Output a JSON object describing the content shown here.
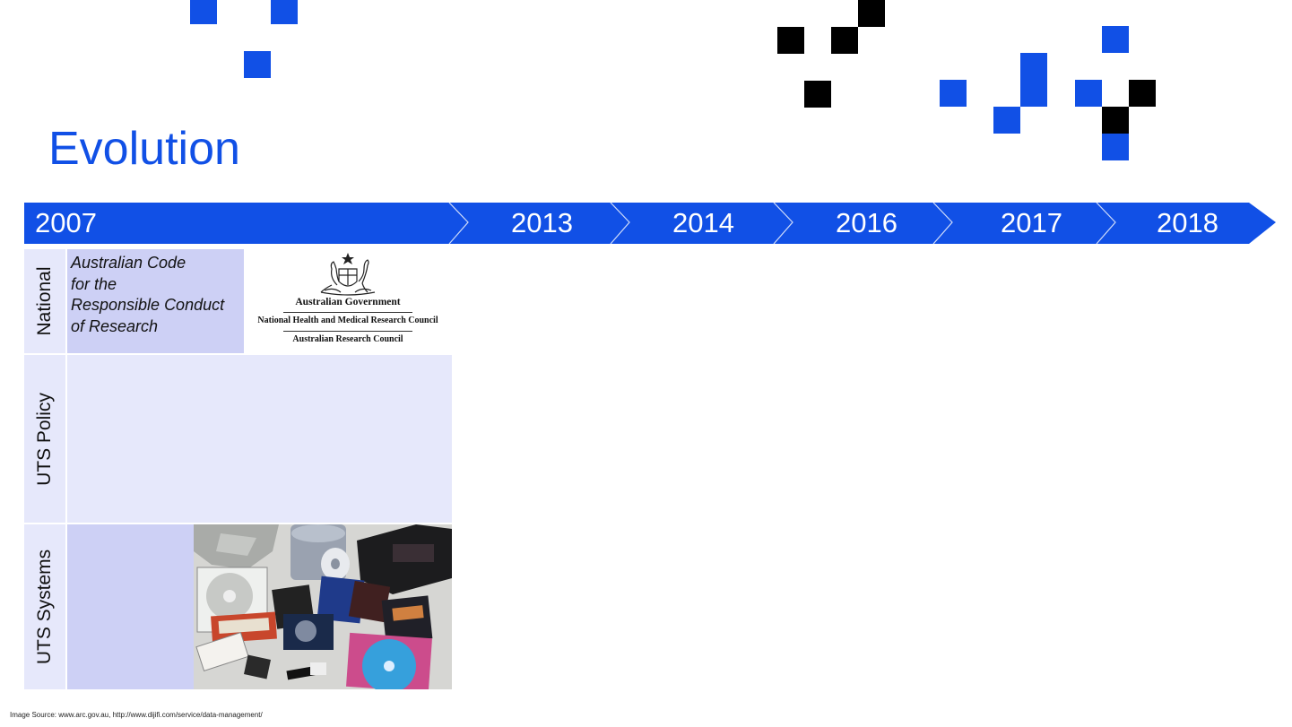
{
  "slide": {
    "title": "Evolution",
    "source_note": "Image Source: www.arc.gov.au, http://www.dijifi.com/service/data-management/"
  },
  "timeline": {
    "years": [
      "2007",
      "2013",
      "2014",
      "2016",
      "2017",
      "2018"
    ],
    "color": "#1150e6"
  },
  "rows": [
    {
      "label": "National"
    },
    {
      "label": "UTS Policy"
    },
    {
      "label": "UTS Systems"
    }
  ],
  "national": {
    "code_lines": [
      "Australian Code",
      "for the",
      "Responsible Conduct",
      "of Research"
    ],
    "logo": {
      "line1": "Australian Government",
      "line2": "National Health and Medical Research Council",
      "line3": "Australian Research Council"
    }
  },
  "colors": {
    "accent": "#1150e6",
    "row_light": "#e6e8fb",
    "row_mid": "#cdd0f5"
  },
  "icons": [
    "coat-of-arms-icon",
    "storage-media-photo"
  ]
}
